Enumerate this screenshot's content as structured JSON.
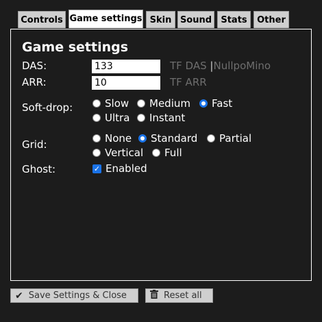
{
  "tabs": [
    {
      "label": "Controls",
      "active": false
    },
    {
      "label": "Game settings",
      "active": true
    },
    {
      "label": "Skin",
      "active": false
    },
    {
      "label": "Sound",
      "active": false
    },
    {
      "label": "Stats",
      "active": false
    },
    {
      "label": "Other",
      "active": false
    }
  ],
  "panel": {
    "title": "Game settings",
    "das": {
      "label": "DAS:",
      "value": "133",
      "hint_a": "TF DAS",
      "separator": "|",
      "hint_b": "NullpoMino"
    },
    "arr": {
      "label": "ARR:",
      "value": "10",
      "hint": "TF ARR"
    },
    "softdrop": {
      "label": "Soft-drop:",
      "options": [
        {
          "label": "Slow",
          "checked": false
        },
        {
          "label": "Medium",
          "checked": false
        },
        {
          "label": "Fast",
          "checked": true
        },
        {
          "label": "Ultra",
          "checked": false
        },
        {
          "label": "Instant",
          "checked": false
        }
      ]
    },
    "grid": {
      "label": "Grid:",
      "options": [
        {
          "label": "None",
          "checked": false
        },
        {
          "label": "Standard",
          "checked": true
        },
        {
          "label": "Partial",
          "checked": false
        },
        {
          "label": "Vertical",
          "checked": false
        },
        {
          "label": "Full",
          "checked": false
        }
      ]
    },
    "ghost": {
      "label": "Ghost:",
      "option": "Enabled",
      "checked": true
    }
  },
  "footer": {
    "save_label": "Save Settings & Close",
    "save_icon": "checkmark-icon",
    "reset_label": "Reset all",
    "reset_icon": "trash-icon"
  },
  "colors": {
    "background": "#1c1c1c",
    "accent": "#1a73e8",
    "tab": "#cfcfcf",
    "hint": "#6e6e6e"
  }
}
